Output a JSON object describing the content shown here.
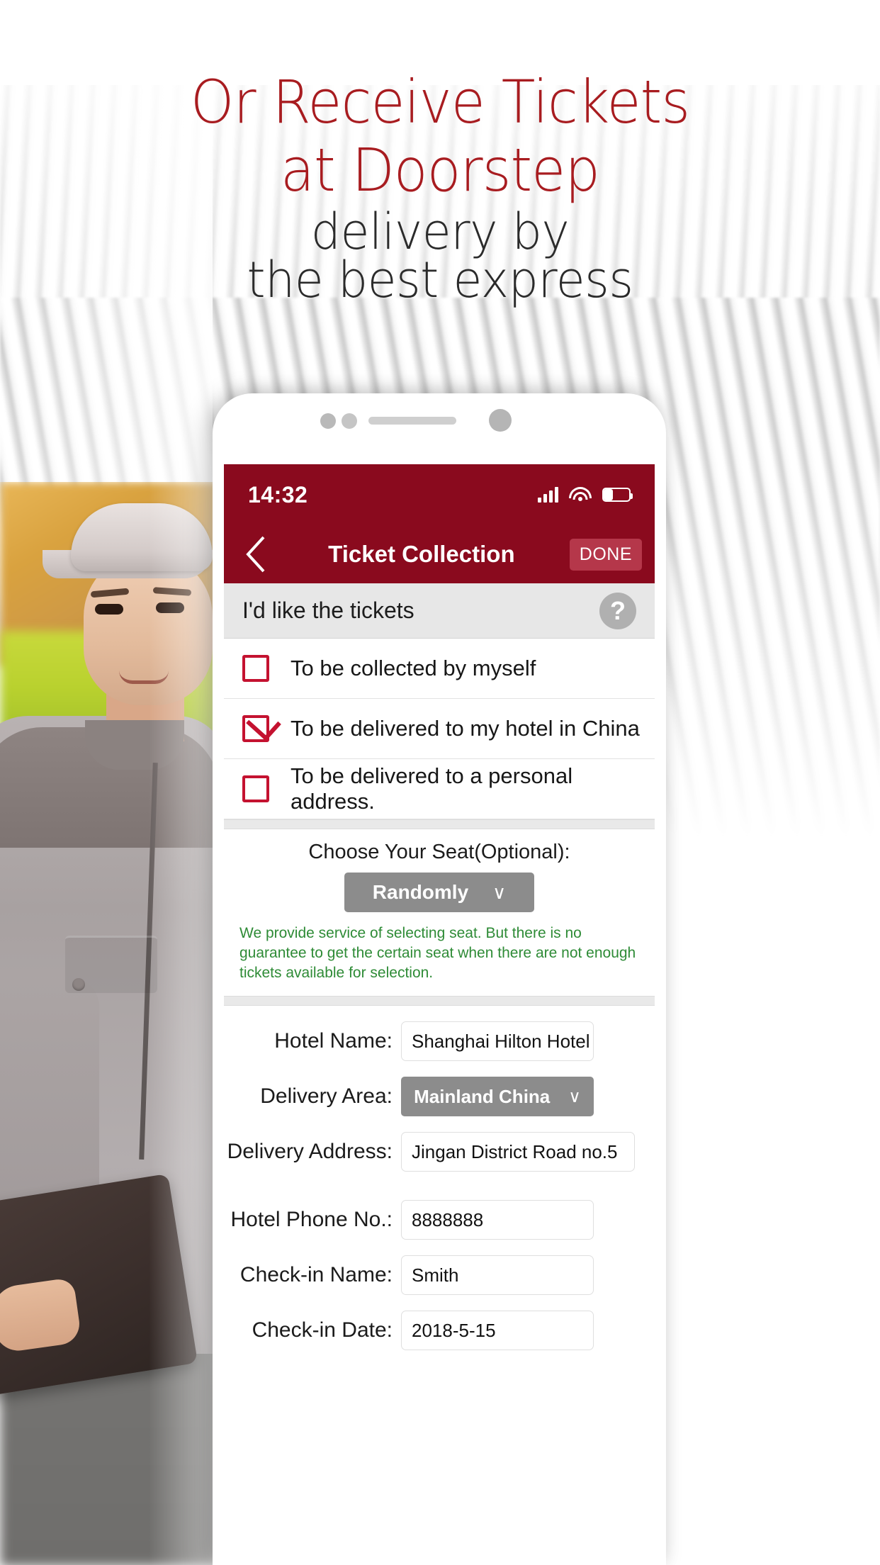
{
  "promo": {
    "headline_line1": "Or Receive Tickets",
    "headline_line2": "at Doorstep",
    "subhead_line1": "delivery by",
    "subhead_line2": "the best express",
    "headline_color": "#A81C20",
    "subhead_color": "#2b2b2b"
  },
  "phone": {
    "status": {
      "time": "14:32",
      "signal_icon": "cellular-signal-icon",
      "wifi_icon": "wifi-icon",
      "battery_icon": "battery-icon",
      "battery_level": "36%"
    },
    "nav": {
      "back_icon": "chevron-left-icon",
      "title": "Ticket Collection",
      "done_label": "DONE",
      "bar_color": "#8A0A1E",
      "done_color": "#B5374A"
    },
    "section": {
      "title": "I'd like the tickets",
      "help_icon": "question-mark-icon"
    },
    "options": [
      {
        "label": "To be collected by myself",
        "checked": false
      },
      {
        "label": "To be delivered to my hotel in China",
        "checked": true
      },
      {
        "label": "To be delivered to a personal address.",
        "checked": false
      }
    ],
    "seat": {
      "title": "Choose Your Seat(Optional):",
      "selected": "Randomly",
      "chevron": "∨",
      "note": "We provide service of selecting seat. But there is no guarantee to get the certain seat when there are not enough tickets available for selection.",
      "note_color": "#2E8B36"
    },
    "form": {
      "fields": [
        {
          "label": "Hotel Name:",
          "value": "Shanghai Hilton Hotel",
          "type": "text"
        },
        {
          "label": "Delivery Area:",
          "value": "Mainland China",
          "type": "select"
        },
        {
          "label": "Delivery Address:",
          "value": "Jingan District Road no.5",
          "type": "text"
        },
        {
          "label": "Hotel Phone No.:",
          "value": "8888888",
          "type": "text"
        },
        {
          "label": "Check-in Name:",
          "value": "Smith",
          "type": "text"
        },
        {
          "label": "Check-in Date:",
          "value": "2018-5-15",
          "type": "text"
        }
      ],
      "chevron": "∨"
    },
    "accent_checkbox_color": "#C41230"
  }
}
